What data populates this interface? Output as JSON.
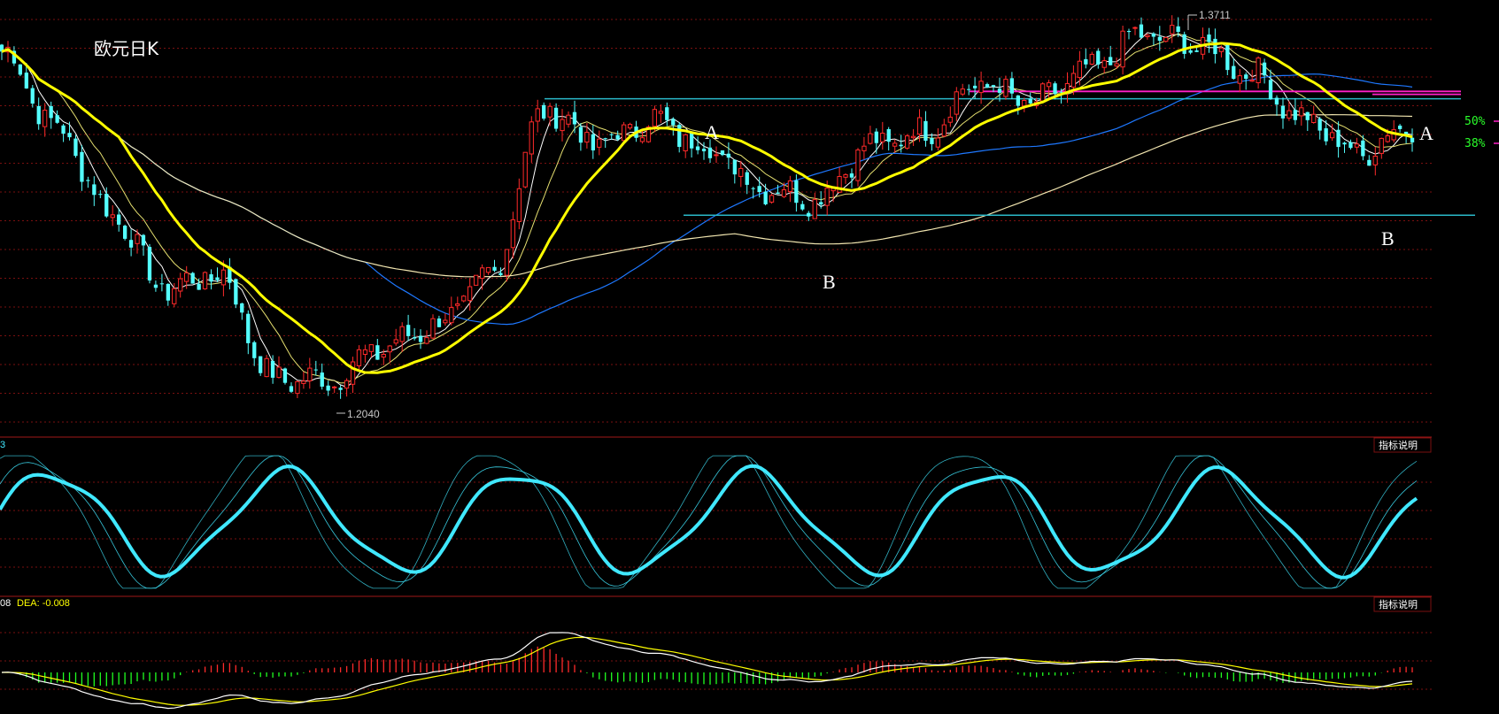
{
  "title": "欧元日K",
  "price_high_label": "1.3711",
  "price_low_label": "1.2040",
  "annotations": {
    "a1": "A",
    "a2": "A",
    "b1": "B",
    "b2": "B",
    "fib50": "50%",
    "fib38": "38%"
  },
  "kdj_panel": {
    "value_label": "3",
    "button": "指标说明"
  },
  "macd_panel": {
    "dif_label": "08",
    "dea_label": "DEA: -0.008",
    "button": "指标说明"
  },
  "colors": {
    "up": "#ff2a2a",
    "down": "#54ffff",
    "ma_thick": "#ffff00",
    "ma_white": "#ffffff",
    "ma_yellow_thin": "#e6e070",
    "ma_blue": "#1e78ff",
    "ma_beige": "#f2e6b0",
    "hline_cyan": "#2ab8c8",
    "hline_magenta": "#ff20c8",
    "grid": "#7a1010",
    "fib_text": "#2aff2a",
    "kdj": "#40e8ff",
    "macd_dif": "#ffffff",
    "macd_dea": "#ffff00",
    "hist_up": "#ff2a2a",
    "hist_down": "#20ff20"
  },
  "chart_data": {
    "type": "candlestick",
    "title": "欧元日K",
    "ylim": [
      1.1909,
      1.3773
    ],
    "price_high": 1.3711,
    "price_low": 1.204,
    "levels": [
      {
        "label": "A",
        "value": 1.3344
      },
      {
        "label": "B",
        "value": 1.2838
      },
      {
        "label": "50%",
        "value": 1.3376
      },
      {
        "label": "38%",
        "value": 1.3344
      }
    ],
    "trend_anchor_closes": [
      1.355,
      1.322,
      1.285,
      1.252,
      1.258,
      1.213,
      1.212,
      1.226,
      1.236,
      1.257,
      1.33,
      1.315,
      1.325,
      1.313,
      1.296,
      1.291,
      1.314,
      1.32,
      1.341,
      1.332,
      1.346,
      1.362,
      1.358,
      1.346,
      1.325,
      1.311,
      1.323
    ]
  }
}
